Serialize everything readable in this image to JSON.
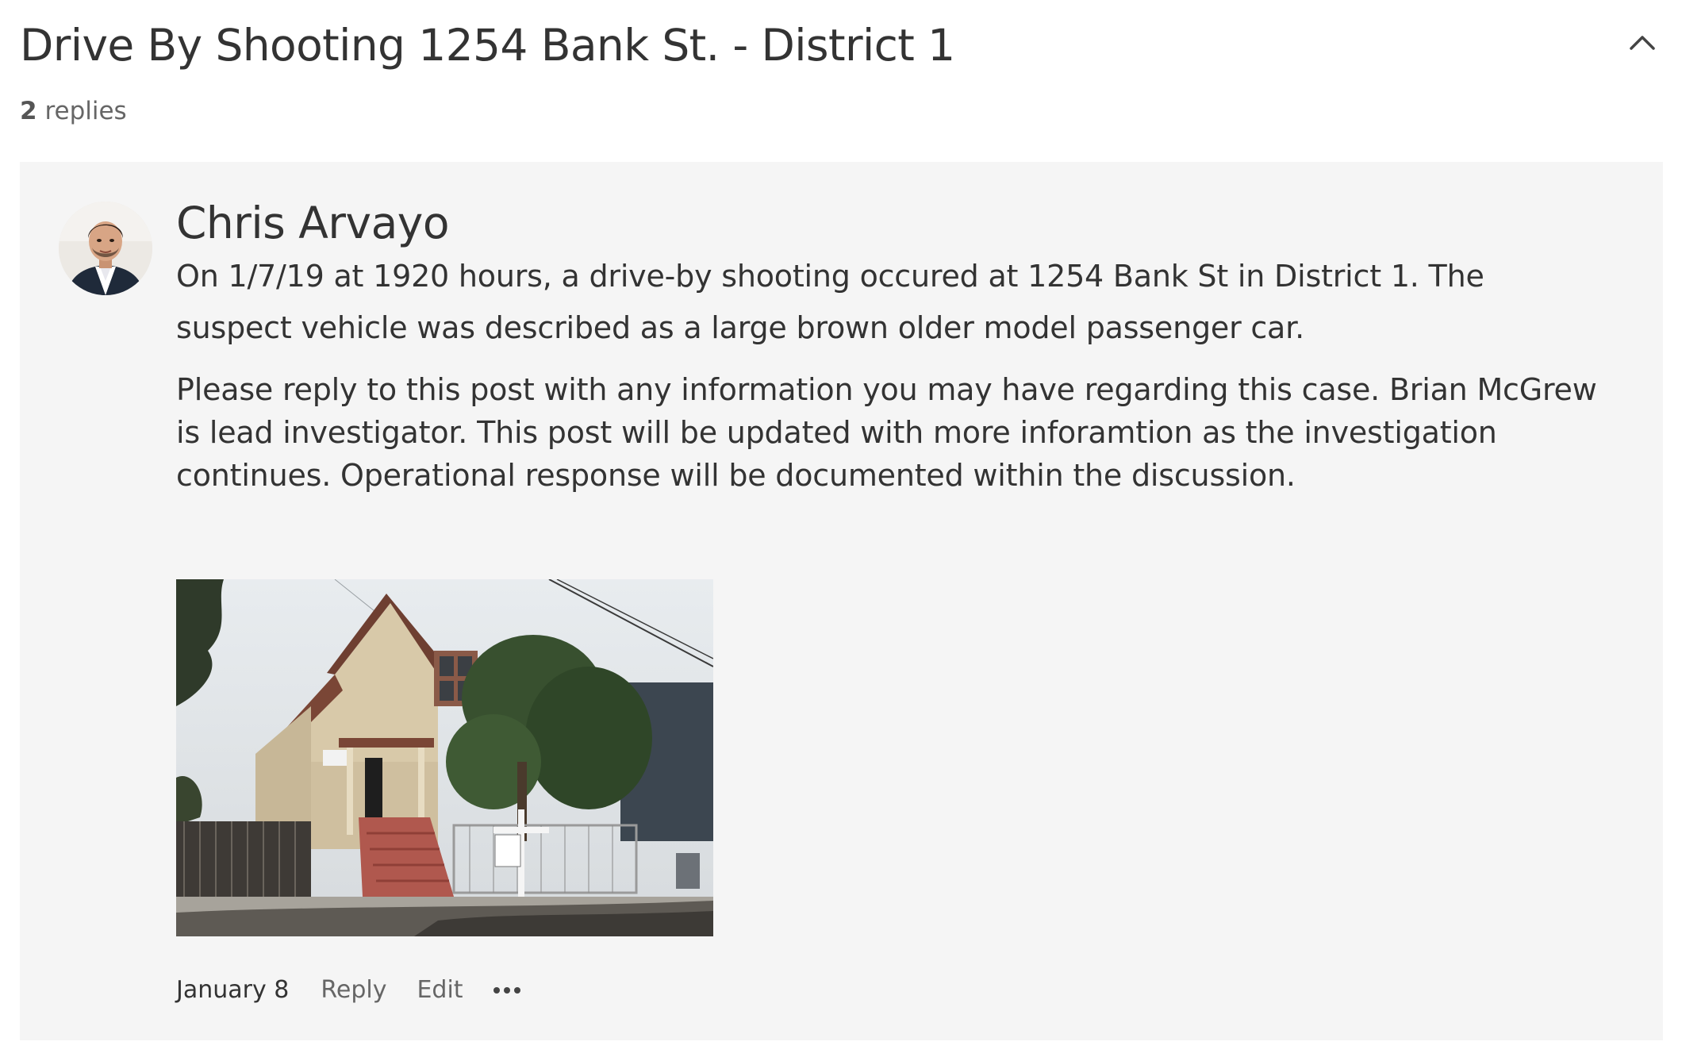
{
  "thread": {
    "title": "Drive By Shooting 1254 Bank St. - District 1",
    "reply_count": "2",
    "reply_label": "replies",
    "collapse_icon": "chevron-up-icon"
  },
  "post": {
    "author": "Chris Arvayo",
    "avatar_icon": "user-avatar",
    "paragraphs": [
      "On 1/7/19 at 1920 hours, a drive-by shooting occured at 1254 Bank St in District 1.  The suspect vehicle was described as a large brown older model passenger car.",
      "Please reply to this post with any information you may have regarding this case.  Brian McGrew is lead investigator.  This post will be updated with more inforamtion as the investigation continues.  Operational response will be documented within the discussion."
    ],
    "image_alt": "house photo",
    "date": "January 8",
    "actions": {
      "reply": "Reply",
      "edit": "Edit",
      "more_icon": "ellipsis-icon"
    }
  },
  "colors": {
    "card_background": "#f5f5f5",
    "text_primary": "#333333",
    "text_secondary": "#666666"
  }
}
